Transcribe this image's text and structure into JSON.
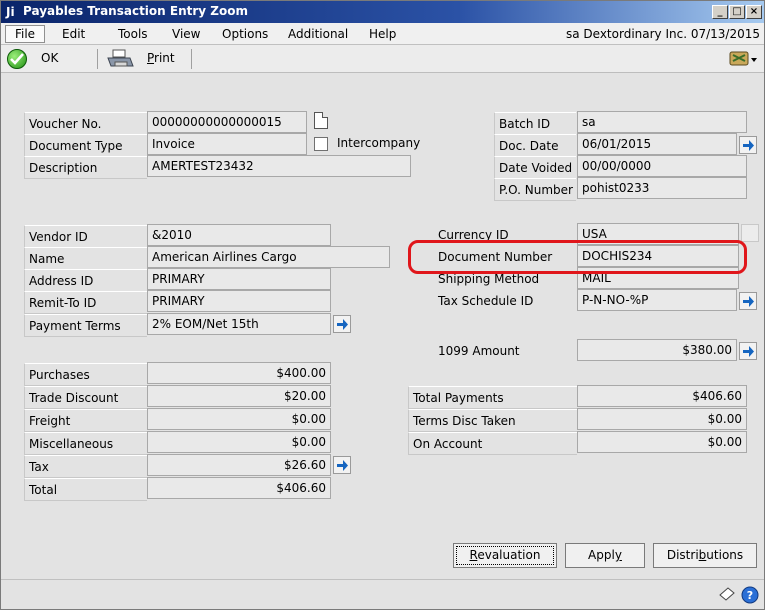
{
  "window": {
    "title": "Payables Transaction Entry Zoom",
    "title_icon": "Ji",
    "controls": [
      "_",
      "□",
      "×"
    ]
  },
  "menu": {
    "items": [
      "File",
      "Edit",
      "Tools",
      "View",
      "Options",
      "Additional",
      "Help"
    ],
    "right_info": "sa  Dextordinary Inc.  07/13/2015"
  },
  "toolbar": {
    "ok_label": "OK",
    "print_label": "Print",
    "ok_icon": "check-circle-icon",
    "print_icon": "printer-icon",
    "help_icon": "help-pointer-icon"
  },
  "left": {
    "voucher_no_label": "Voucher No.",
    "voucher_no": "00000000000000015",
    "document_type_label": "Document Type",
    "document_type": "Invoice",
    "intercompany_label": "Intercompany",
    "intercompany_checked": false,
    "description_label": "Description",
    "description": "AMERTEST23432",
    "vendor_id_label": "Vendor ID",
    "vendor_id": "&2010",
    "name_label": "Name",
    "name": "American Airlines Cargo",
    "address_id_label": "Address ID",
    "address_id": "PRIMARY",
    "remit_to_label": "Remit-To ID",
    "remit_to": "PRIMARY",
    "payment_terms_label": "Payment Terms",
    "payment_terms": "2% EOM/Net 15th"
  },
  "right": {
    "batch_id_label": "Batch ID",
    "batch_id": "sa",
    "doc_date_label": "Doc. Date",
    "doc_date": "06/01/2015",
    "date_voided_label": "Date Voided",
    "date_voided": "00/00/0000",
    "po_number_label": "P.O. Number",
    "po_number": "pohist0233",
    "currency_id_label": "Currency ID",
    "currency_id": "USA",
    "document_number_label": "Document Number",
    "document_number": "DOCHIS234",
    "shipping_method_label": "Shipping Method",
    "shipping_method": "MAIL",
    "tax_schedule_label": "Tax Schedule ID",
    "tax_schedule": "P-N-NO-%P",
    "amount_1099_label": "1099 Amount",
    "amount_1099": "$380.00"
  },
  "totals_left": [
    {
      "label": "Purchases",
      "value": "$400.00"
    },
    {
      "label": "Trade Discount",
      "value": "$20.00"
    },
    {
      "label": "Freight",
      "value": "$0.00"
    },
    {
      "label": "Miscellaneous",
      "value": "$0.00"
    },
    {
      "label": "Tax",
      "value": "$26.60"
    },
    {
      "label": "Total",
      "value": "$406.60"
    }
  ],
  "totals_right": [
    {
      "label": "Total Payments",
      "value": "$406.60"
    },
    {
      "label": "Terms Disc Taken",
      "value": "$0.00"
    },
    {
      "label": "On Account",
      "value": "$0.00"
    }
  ],
  "buttons": {
    "revaluation": "Revaluation",
    "apply": "Apply",
    "distributions": "Distributions"
  },
  "status": {
    "note_icon": "note-icon",
    "help_icon": "help-circle-icon"
  },
  "colors": {
    "highlight": "#e0161b",
    "arrow": "#1565c0",
    "title_bar": "#0a246a"
  }
}
